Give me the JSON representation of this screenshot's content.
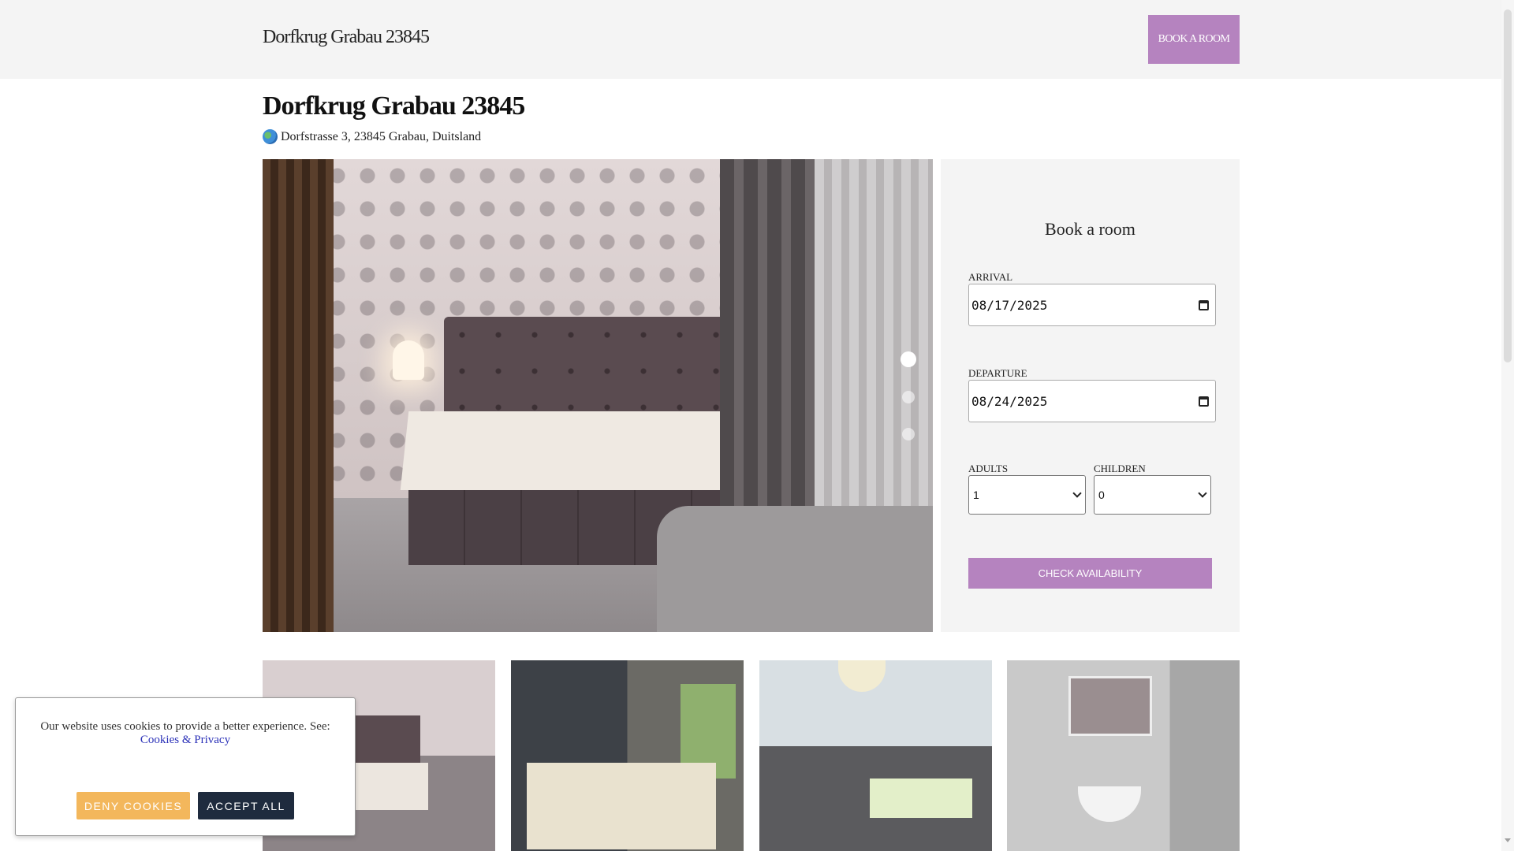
{
  "header": {
    "brand": "Dorfkrug Grabau 23845",
    "book_button": "BOOK A ROOM"
  },
  "hotel": {
    "title": "Dorfkrug Grabau 23845",
    "address": "Dorfstrasse 3, 23845 Grabau, Duitsland",
    "address_icon": "globe-icon"
  },
  "gallery": {
    "slide_count": 3,
    "active_slide": 1
  },
  "booking": {
    "heading": "Book a room",
    "arrival_label": "ARRIVAL",
    "arrival_value": "08/17/2025",
    "departure_label": "DEPARTURE",
    "departure_value": "08/24/2025",
    "adults_label": "ADULTS",
    "adults_value": "1",
    "children_label": "CHILDREN",
    "children_value": "0",
    "check_button": "CHECK AVAILABILITY"
  },
  "cookie": {
    "message": "Our website uses cookies to provide a better experience. See:",
    "link": "Cookies & Privacy",
    "deny_button": "DENY COOKIES",
    "accept_button": "ACCEPT ALL"
  },
  "colors": {
    "accent": "#b583bf",
    "deny": "#f3b75c",
    "accept": "#1f2b3e",
    "link": "#2b31b8"
  }
}
